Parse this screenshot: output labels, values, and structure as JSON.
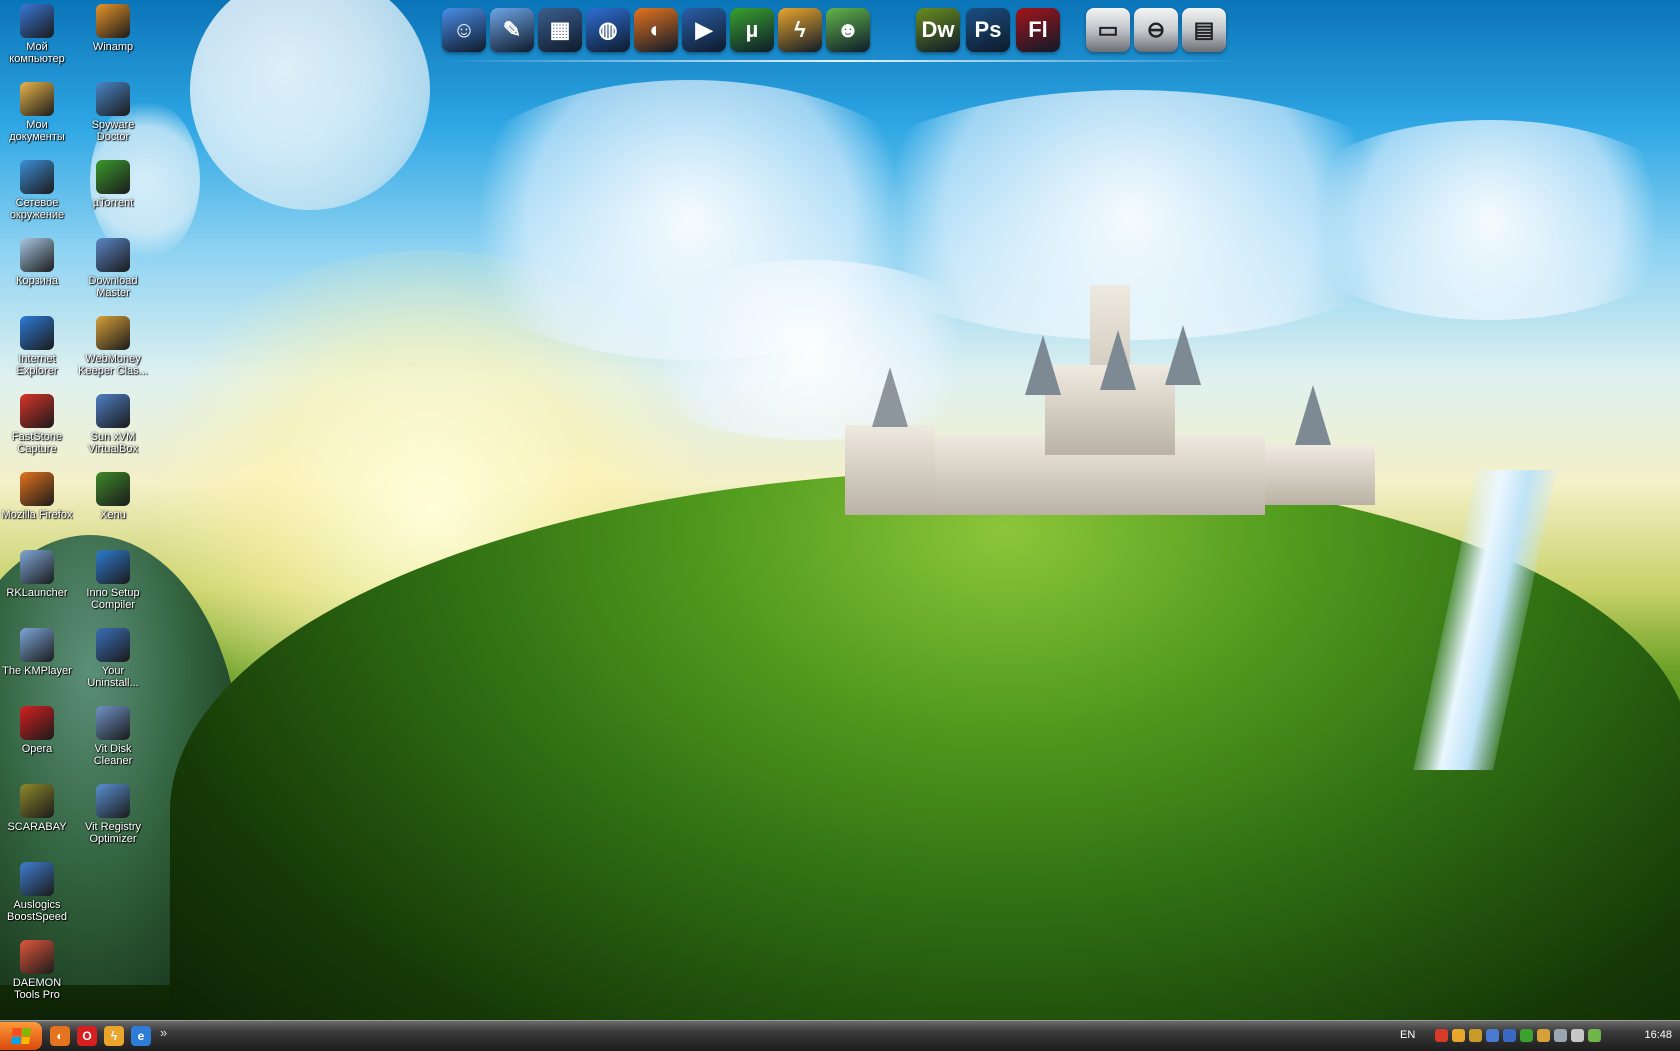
{
  "desktop": {
    "icons_col1": [
      {
        "label": "Мой компьютер",
        "icon": "my-computer-icon",
        "color": "#3a78d8"
      },
      {
        "label": "Мои документы",
        "icon": "my-documents-icon",
        "color": "#e9b64a"
      },
      {
        "label": "Сетевое окружение",
        "icon": "network-icon",
        "color": "#3c8fd6"
      },
      {
        "label": "Корзина",
        "icon": "recycle-bin-icon",
        "color": "#a9c7e3"
      },
      {
        "label": "Internet Explorer",
        "icon": "internet-explorer-icon",
        "color": "#2f7bd8"
      },
      {
        "label": "FastStone Capture",
        "icon": "faststone-capture-icon",
        "color": "#d9342b"
      },
      {
        "label": "Mozilla Firefox",
        "icon": "firefox-icon",
        "color": "#e4731e"
      },
      {
        "label": "RKLauncher",
        "icon": "rklauncher-icon",
        "color": "#7fa8d8"
      },
      {
        "label": "The KMPlayer",
        "icon": "kmplayer-icon",
        "color": "#7ca7d9"
      },
      {
        "label": "Opera",
        "icon": "opera-icon",
        "color": "#d6201f"
      },
      {
        "label": "SCARABAY",
        "icon": "scarabay-icon",
        "color": "#8e8a2a"
      },
      {
        "label": "Auslogics BoostSpeed",
        "icon": "auslogics-icon",
        "color": "#3f7fd0"
      },
      {
        "label": "DAEMON Tools Pro",
        "icon": "daemon-tools-icon",
        "color": "#e0573b"
      }
    ],
    "icons_col2": [
      {
        "label": "Winamp",
        "icon": "winamp-icon",
        "color": "#e8962a"
      },
      {
        "label": "Spyware Doctor",
        "icon": "spyware-doctor-icon",
        "color": "#4a86c8"
      },
      {
        "label": "µTorrent",
        "icon": "utorrent-icon",
        "color": "#3b9a2e"
      },
      {
        "label": "Download Master",
        "icon": "download-master-icon",
        "color": "#5b86c6"
      },
      {
        "label": "WebMoney Keeper Clas...",
        "icon": "webmoney-icon",
        "color": "#d7a13a"
      },
      {
        "label": "Sun xVM VirtualBox",
        "icon": "virtualbox-icon",
        "color": "#4f7fc5"
      },
      {
        "label": "Xenu",
        "icon": "xenu-icon",
        "color": "#3f8a2a"
      },
      {
        "label": "Inno Setup Compiler",
        "icon": "inno-setup-icon",
        "color": "#2e7bd0"
      },
      {
        "label": "Your Uninstall...",
        "icon": "your-uninstaller-icon",
        "color": "#3b6fb8"
      },
      {
        "label": "Vit Disk Cleaner",
        "icon": "vit-disk-cleaner-icon",
        "color": "#6f93c6"
      },
      {
        "label": "Vit Registry Optimizer",
        "icon": "vit-registry-icon",
        "color": "#5a90d2"
      }
    ]
  },
  "dock": {
    "items": [
      {
        "icon": "finder-icon",
        "glyph": "☺",
        "color": "#4a8ee8"
      },
      {
        "icon": "safari-icon",
        "glyph": "✎",
        "color": "#6fa6e8"
      },
      {
        "icon": "dashboard-icon",
        "glyph": "▦",
        "color": "#3c5f8e"
      },
      {
        "icon": "network-globe-icon",
        "glyph": "◍",
        "color": "#2f6fd6"
      },
      {
        "icon": "firefox-dock-icon",
        "glyph": "◐",
        "color": "#e4731e"
      },
      {
        "icon": "media-player-icon",
        "glyph": "▶",
        "color": "#2a5fa8"
      },
      {
        "icon": "utorrent-dock-icon",
        "glyph": "µ",
        "color": "#3aa22e"
      },
      {
        "icon": "daemon-dock-icon",
        "glyph": "ϟ",
        "color": "#e9a52c"
      },
      {
        "icon": "messenger-icon",
        "glyph": "☻",
        "color": "#63b54a"
      },
      {
        "icon": "dreamweaver-icon",
        "glyph": "Dw",
        "color": "#6a8d1e"
      },
      {
        "icon": "photoshop-icon",
        "glyph": "Ps",
        "color": "#1c4f82"
      },
      {
        "icon": "flash-icon",
        "glyph": "Fl",
        "color": "#a3141a"
      },
      {
        "icon": "hard-drive-icon",
        "glyph": "▭",
        "color": "#bfc3c8"
      },
      {
        "icon": "eject-drive-icon",
        "glyph": "⊖",
        "color": "#c9ccd0"
      },
      {
        "icon": "printer-icon",
        "glyph": "▤",
        "color": "#c3c6ca"
      }
    ]
  },
  "taskbar": {
    "quick_launch": [
      {
        "icon": "firefox-quicklaunch-icon",
        "glyph": "◐",
        "color": "#e4731e"
      },
      {
        "icon": "opera-quicklaunch-icon",
        "glyph": "O",
        "color": "#d6201f"
      },
      {
        "icon": "daemon-quicklaunch-icon",
        "glyph": "ϟ",
        "color": "#e9a52c"
      },
      {
        "icon": "ie-quicklaunch-icon",
        "glyph": "e",
        "color": "#2f7bd8"
      }
    ],
    "chevron": "»",
    "language": "EN",
    "tray_icons": [
      {
        "icon": "tray-arrow-icon",
        "color": "#d83a2a"
      },
      {
        "icon": "tray-daemon-icon",
        "color": "#e9a52c"
      },
      {
        "icon": "tray-antivirus-icon",
        "color": "#c99b2a"
      },
      {
        "icon": "tray-network-icon",
        "color": "#4a7bd0"
      },
      {
        "icon": "tray-display-icon",
        "color": "#3a69c2"
      },
      {
        "icon": "tray-utorrent-icon",
        "color": "#3aa22e"
      },
      {
        "icon": "tray-webmoney-icon",
        "color": "#d7a13a"
      },
      {
        "icon": "tray-keyboard-icon",
        "color": "#9aa6b2"
      },
      {
        "icon": "tray-volume-icon",
        "color": "#c7c7c7"
      },
      {
        "icon": "tray-safe-remove-icon",
        "color": "#6fb54a"
      }
    ],
    "clock": "16:48"
  }
}
